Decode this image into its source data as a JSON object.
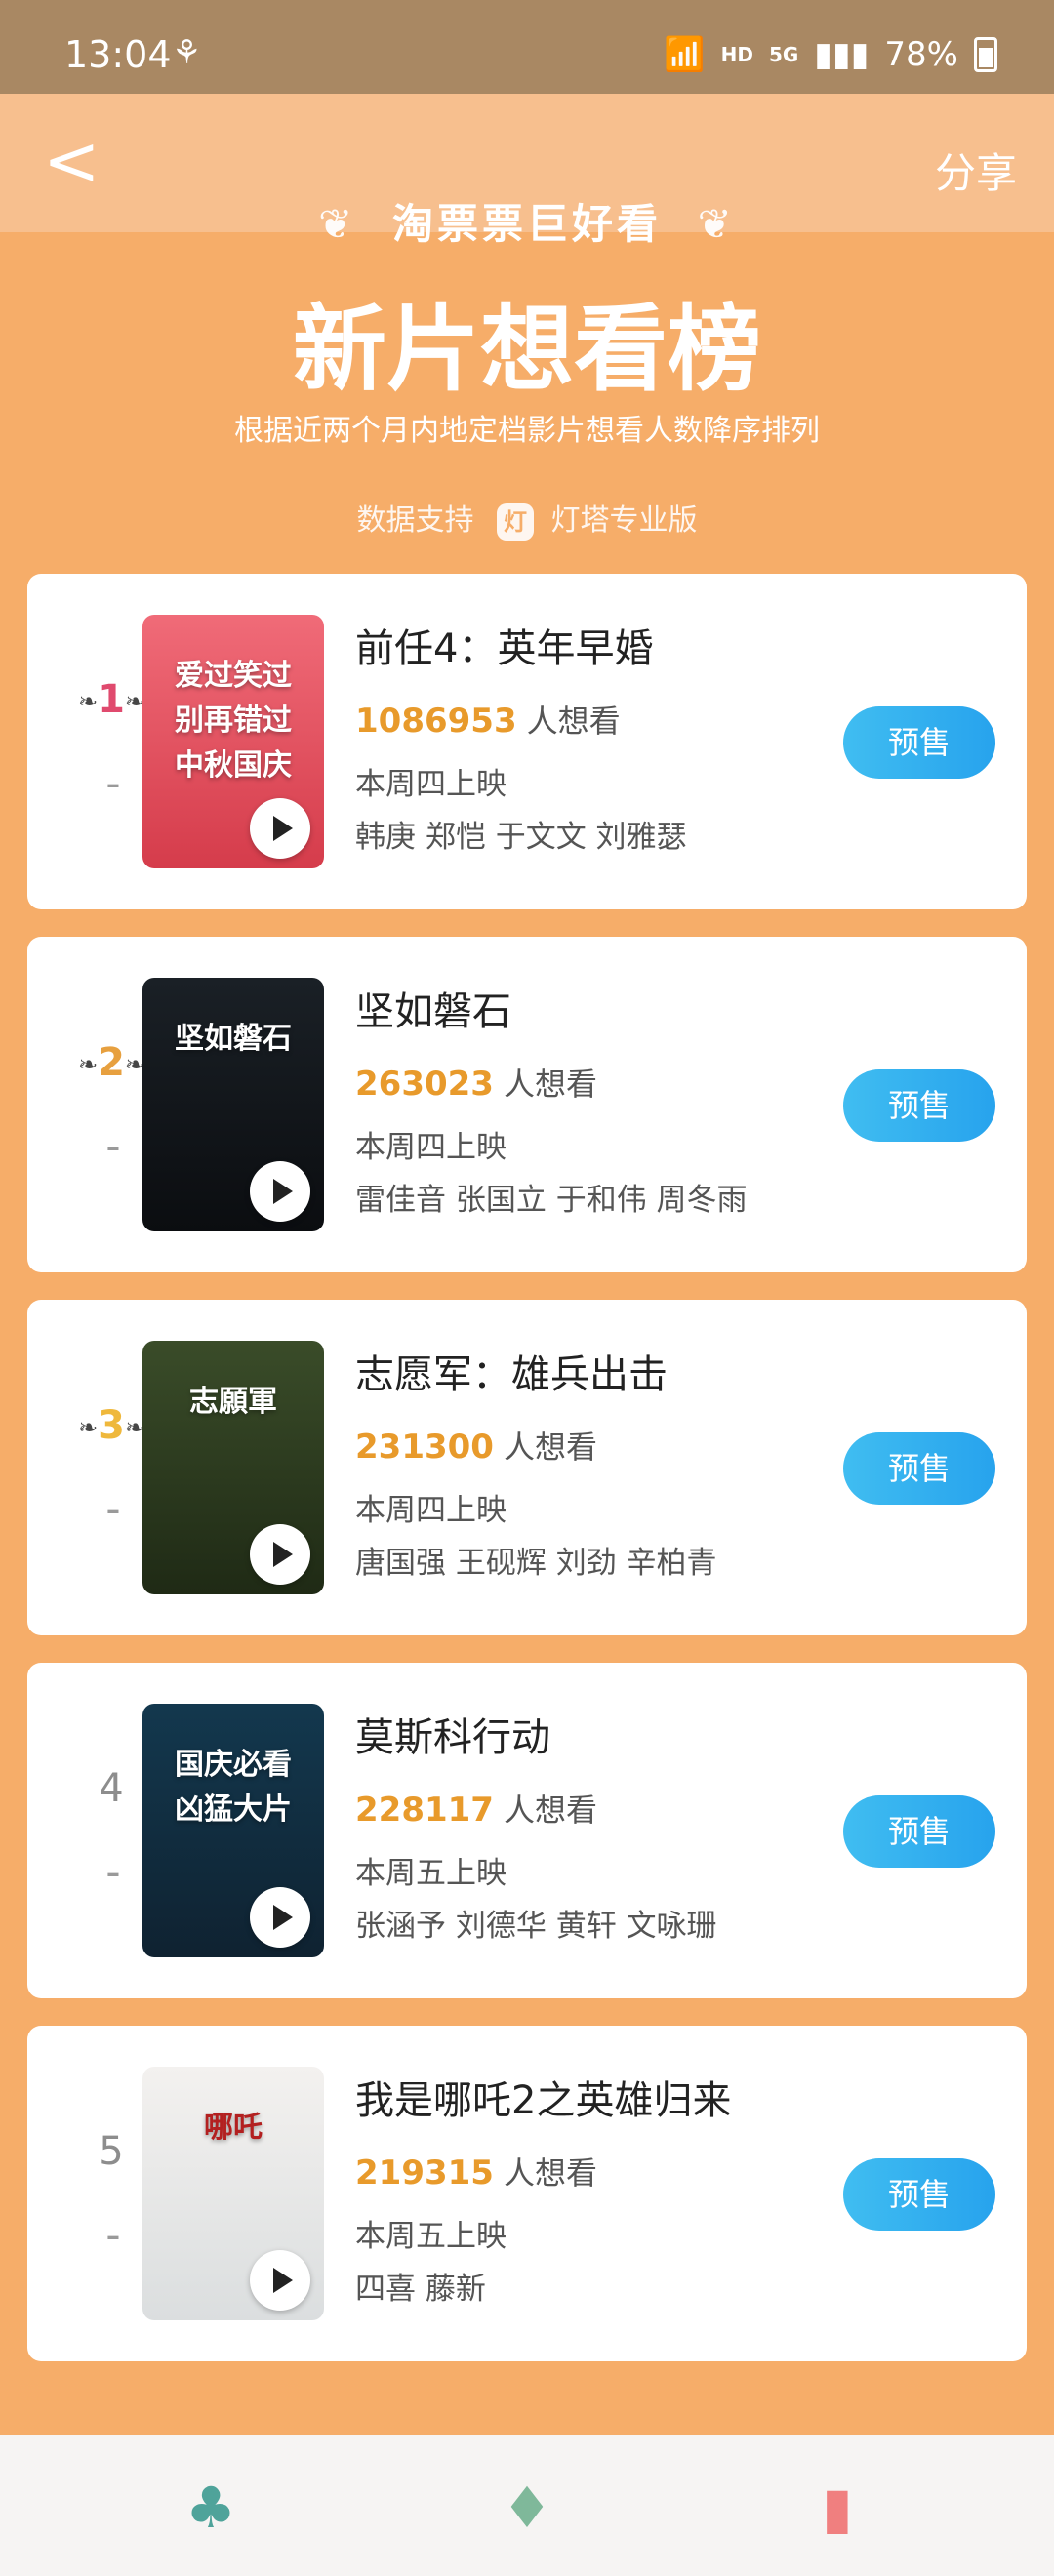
{
  "status_bar": {
    "time": "13:04",
    "network_hd": "HD",
    "network_5g": "5G",
    "battery": "78%"
  },
  "header": {
    "back_icon": "<",
    "share_label": "分享"
  },
  "banner": {
    "brand": "淘票票巨好看",
    "title": "新片想看榜",
    "subtitle": "根据近两个月内地定档影片想看人数降序排列",
    "data_support": "数据支持",
    "source": "灯塔专业版"
  },
  "movies": [
    {
      "rank": "1",
      "title": "前任4：英年早婚",
      "want_count": "1086953",
      "want_label": "人想看",
      "release": "本周四上映",
      "cast": "韩庚 郑恺 于文文 刘雅瑟",
      "button": "预售",
      "poster_text": "爱过笑过\n别再错过\n中秋国庆",
      "poster_colors": [
        "#f06b78",
        "#d53c4b"
      ]
    },
    {
      "rank": "2",
      "title": "坚如磐石",
      "want_count": "263023",
      "want_label": "人想看",
      "release": "本周四上映",
      "cast": "雷佳音 张国立 于和伟 周冬雨",
      "button": "预售",
      "poster_text": "坚如磐石",
      "poster_colors": [
        "#1a2026",
        "#0b0d10"
      ]
    },
    {
      "rank": "3",
      "title": "志愿军：雄兵出击",
      "want_count": "231300",
      "want_label": "人想看",
      "release": "本周四上映",
      "cast": "唐国强 王砚辉 刘劲 辛柏青",
      "button": "预售",
      "poster_text": "志願軍",
      "poster_colors": [
        "#3a4c29",
        "#1f2a15"
      ]
    },
    {
      "rank": "4",
      "title": "莫斯科行动",
      "want_count": "228117",
      "want_label": "人想看",
      "release": "本周五上映",
      "cast": "张涵予 刘德华 黄轩 文咏珊",
      "button": "预售",
      "poster_text": "国庆必看\n凶猛大片",
      "poster_colors": [
        "#13384e",
        "#0f2231"
      ]
    },
    {
      "rank": "5",
      "title": "我是哪吒2之英雄归来",
      "want_count": "219315",
      "want_label": "人想看",
      "release": "本周五上映",
      "cast": "四喜 藤新",
      "button": "预售",
      "poster_text": "哪吒",
      "poster_colors": [
        "#f3f1ef",
        "#dbdedf"
      ]
    }
  ],
  "bottom_tabs": [
    {
      "icon": "cactus-icon"
    },
    {
      "icon": "cupcake-icon"
    },
    {
      "icon": "drink-icon"
    }
  ]
}
